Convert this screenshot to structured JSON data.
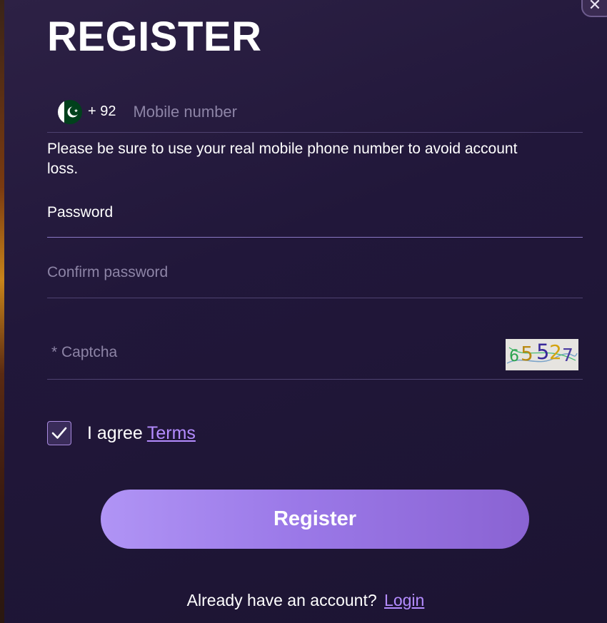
{
  "title": "REGISTER",
  "phone": {
    "country_code": "+ 92",
    "placeholder": "Mobile number",
    "flag_icon": "pakistan-flag-icon"
  },
  "hint": "Please be sure to use your real mobile phone number to avoid account loss.",
  "password": {
    "placeholder": "Password"
  },
  "confirm_password": {
    "placeholder": "Confirm password"
  },
  "captcha": {
    "placeholder": "* Captcha",
    "code": "65527"
  },
  "agree": {
    "text": "I agree",
    "terms_link": "Terms",
    "checked": true
  },
  "register_button": "Register",
  "login": {
    "prompt": "Already have an account?",
    "link": "Login"
  },
  "colors": {
    "accent": "#b48cff",
    "button_start": "#b094f5",
    "button_end": "#8a63d3",
    "background": "#21173a"
  }
}
